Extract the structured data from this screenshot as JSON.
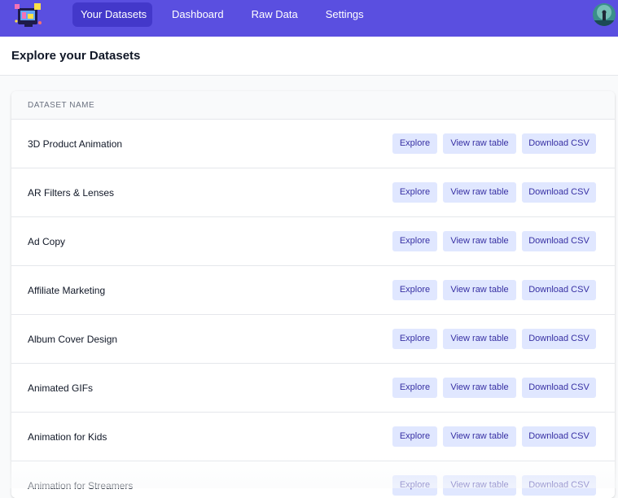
{
  "nav": {
    "tabs": [
      {
        "label": "Your Datasets",
        "active": true
      },
      {
        "label": "Dashboard",
        "active": false
      },
      {
        "label": "Raw Data",
        "active": false
      },
      {
        "label": "Settings",
        "active": false
      }
    ],
    "logo_icon": "app-logo-icon",
    "avatar_icon": "user-avatar-icon"
  },
  "page": {
    "title": "Explore your Datasets"
  },
  "table": {
    "header": "Dataset Name",
    "actions": {
      "explore": "Explore",
      "raw": "View raw table",
      "csv": "Download CSV"
    },
    "rows": [
      {
        "name": "3D Product Animation"
      },
      {
        "name": "AR Filters & Lenses"
      },
      {
        "name": "Ad Copy"
      },
      {
        "name": "Affiliate Marketing"
      },
      {
        "name": "Album Cover Design"
      },
      {
        "name": "Animated GIFs"
      },
      {
        "name": "Animation for Kids"
      },
      {
        "name": "Animation for Streamers"
      }
    ]
  },
  "colors": {
    "nav_bg": "#5a4fe0",
    "nav_active": "#4338ca",
    "button_bg": "#e0e7ff",
    "button_text": "#3730a3"
  }
}
